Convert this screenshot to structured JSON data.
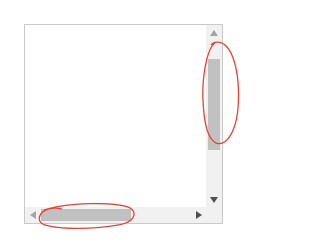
{
  "scrollbars": {
    "vertical": {
      "thumb_start_fraction": 0.12,
      "thumb_size_fraction": 0.6
    },
    "horizontal": {
      "thumb_start_fraction": 0.0,
      "thumb_size_fraction": 0.6
    }
  },
  "icons": {
    "up": "triangle-up-icon",
    "down": "triangle-down-icon",
    "left": "triangle-left-icon",
    "right": "triangle-right-icon"
  },
  "colors": {
    "track": "#f1f1f1",
    "thumb": "#c1c1c1",
    "arrow": "#505050",
    "annotation": "#e8412f",
    "border": "#c9c9c9"
  }
}
